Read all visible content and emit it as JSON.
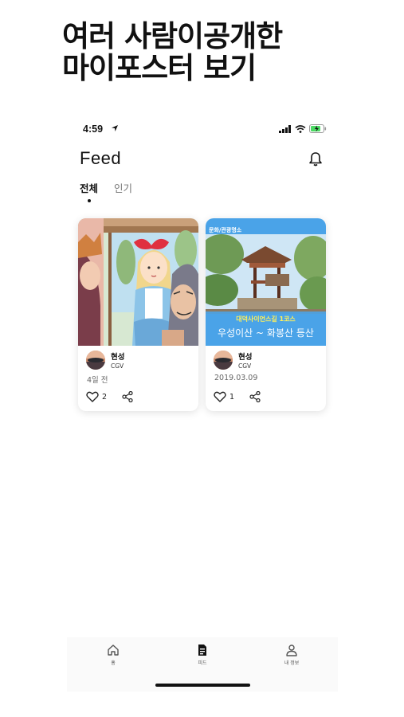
{
  "headline": {
    "line1": "여러 사람이공개한",
    "line2": "마이포스터 보기"
  },
  "status_bar": {
    "time": "4:59",
    "location_icon": "location-arrow-icon",
    "signal_icon": "cellular-signal-icon",
    "wifi_icon": "wifi-icon",
    "battery_icon": "battery-charging-icon",
    "battery_color": "#4cd964"
  },
  "header": {
    "title": "Feed",
    "bell_icon": "bell-icon"
  },
  "tabs": [
    {
      "label": "전체",
      "active": true
    },
    {
      "label": "인기",
      "active": false
    }
  ],
  "feed": [
    {
      "user": "현성",
      "subtitle": "CGV",
      "date": "4일 전",
      "likes": "2",
      "image": "cartoon-illustration"
    },
    {
      "user": "현성",
      "subtitle": "CGV",
      "date": "2019.03.09",
      "likes": "1",
      "image": "pavilion-photo",
      "poster_top_label": "문화/관광명소",
      "poster_subtitle": "대덕사이언스길 1코스",
      "poster_title": "우성이산 ~ 화봉산 등산"
    }
  ],
  "bottom_nav": [
    {
      "label": "홈",
      "icon": "home-icon",
      "active": false
    },
    {
      "label": "피드",
      "icon": "feed-document-icon",
      "active": true
    },
    {
      "label": "내 정보",
      "icon": "person-icon",
      "active": false
    }
  ],
  "colors": {
    "poster_blue": "#4aa3e8",
    "text_primary": "#111111"
  }
}
